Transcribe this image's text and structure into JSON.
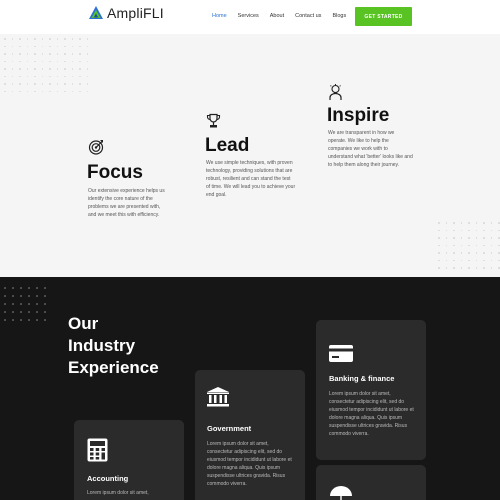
{
  "brand": {
    "name": "AmpliFLI",
    "colors": {
      "blue": "#2a72d6",
      "green": "#58c322",
      "dark": "#161616"
    }
  },
  "nav": {
    "items": [
      {
        "label": "Home",
        "active": true
      },
      {
        "label": "Services",
        "active": false
      },
      {
        "label": "About",
        "active": false
      },
      {
        "label": "Contact us",
        "active": false
      },
      {
        "label": "Blogs",
        "active": false
      }
    ],
    "cta_label": "GET STARTED"
  },
  "values": [
    {
      "icon": "target-icon",
      "title": "Focus",
      "text": "Our extensive experience helps us identify the core nature of the problems we are presented with, and we meet this with efficiency."
    },
    {
      "icon": "trophy-icon",
      "title": "Lead",
      "text": "We use simple techniques, with proven technology, providing solutions that are robust, resilient and can stand the test of time. We will lead you to achieve your end goal."
    },
    {
      "icon": "lightbulb-person-icon",
      "title": "Inspire",
      "text": "We are transparent in how we operate. We like to help the companies we work with to understand what 'better' looks like and to help them along their journey."
    }
  ],
  "industry": {
    "heading_lines": [
      "Our",
      "Industry",
      "Experience"
    ],
    "cards": [
      {
        "icon": "calculator-icon",
        "title": "Accounting",
        "text": "Lorem ipsum dolor sit amet,"
      },
      {
        "icon": "bank-icon",
        "title": "Government",
        "text": "Lorem ipsum dolor sit amet, consectetur adipiscing elit, sed do eiusmod tempor incididunt ut labore et dolore magna aliqua. Quis ipsum suspendisse ultrices gravida. Risus commodo viverra."
      },
      {
        "icon": "credit-card-icon",
        "title": "Banking & finance",
        "text": "Lorem ipsum dolor sit amet, consectetur adipiscing elit, sed do eiusmod tempor incididunt ut labore et dolore magna aliqua. Quis ipsum suspendisse ultrices gravida. Risus commodo viverra."
      },
      {
        "icon": "umbrella-icon",
        "title": "",
        "text": ""
      }
    ]
  }
}
